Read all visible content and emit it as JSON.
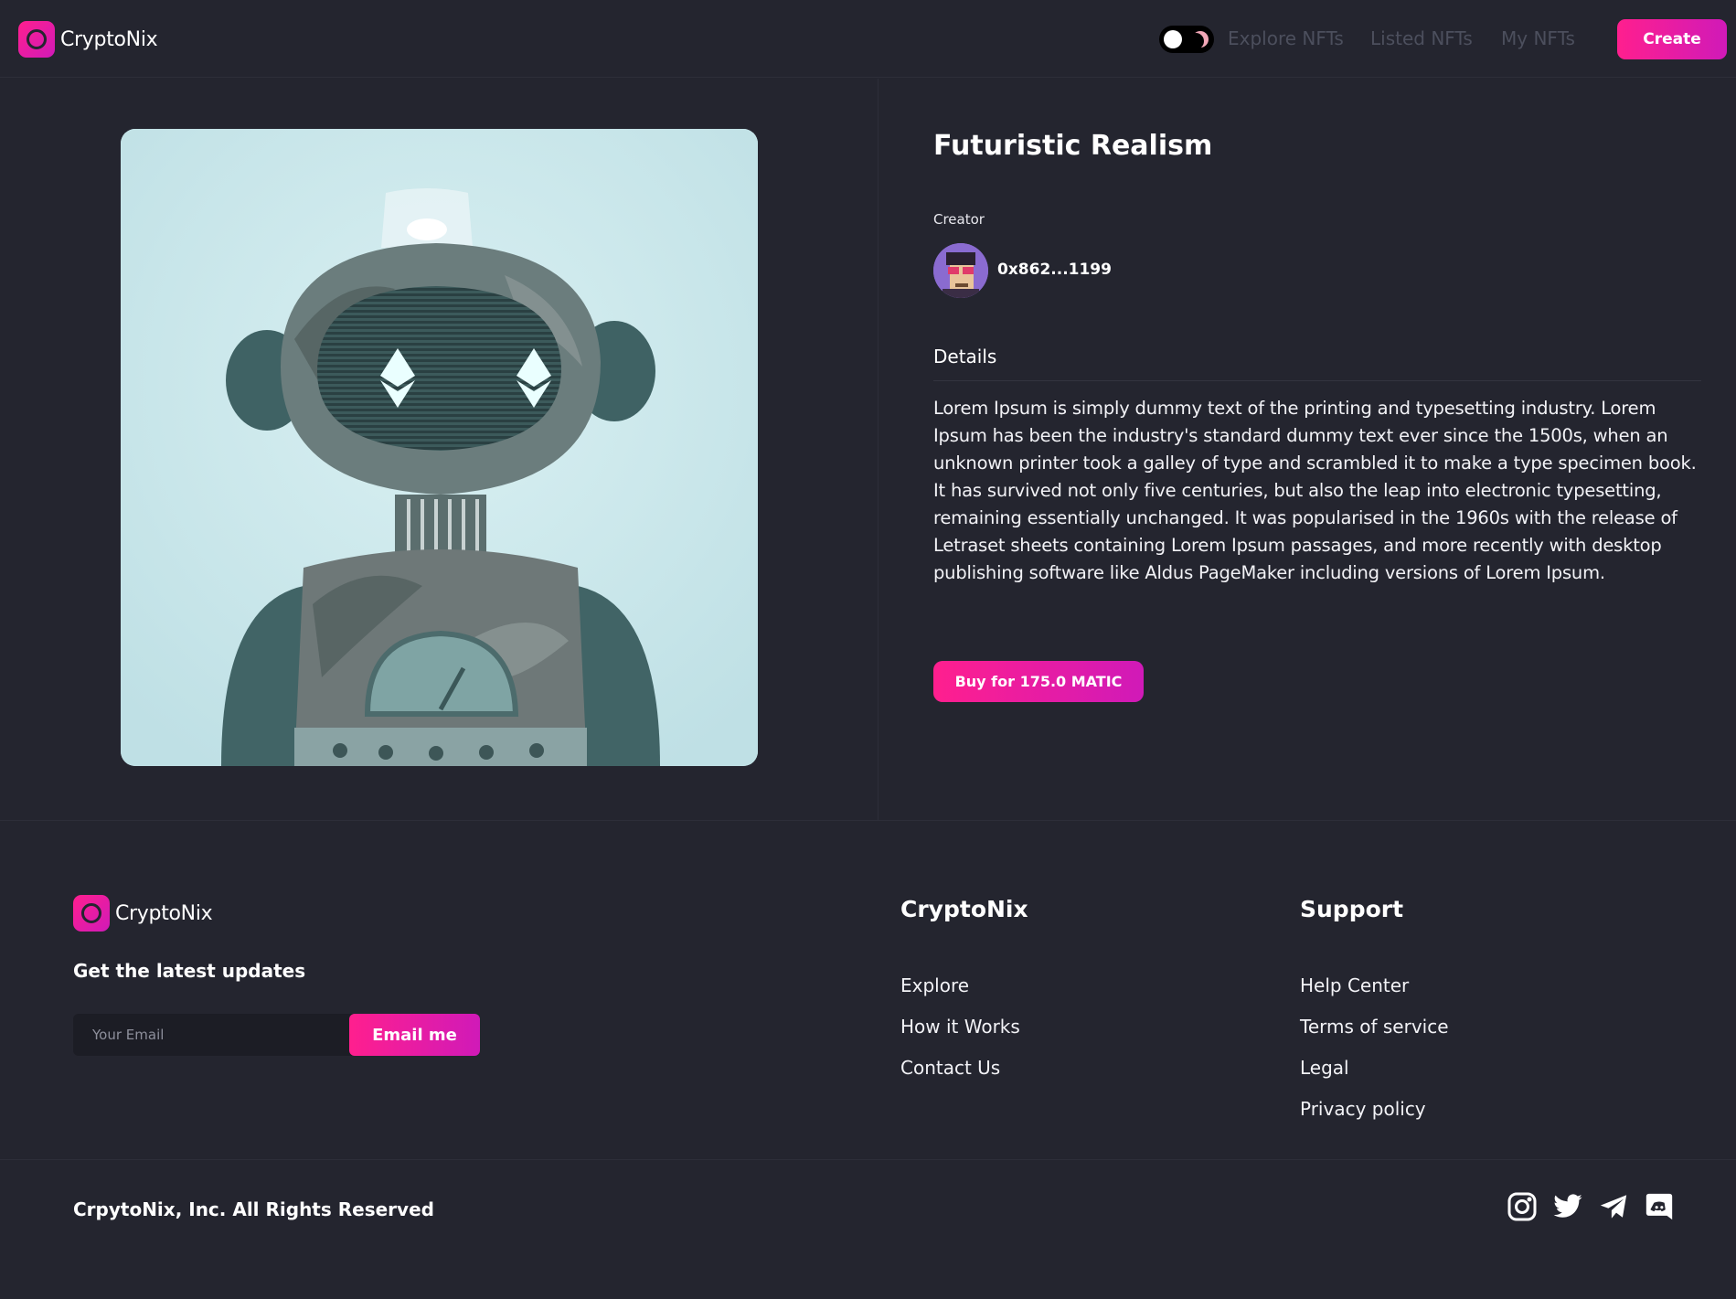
{
  "brand": {
    "name": "CryptoNix"
  },
  "header": {
    "nav": [
      "Explore NFTs",
      "Listed NFTs",
      "My NFTs"
    ],
    "create_label": "Create"
  },
  "nft": {
    "title": "Futuristic Realism",
    "creator_label": "Creator",
    "creator_address": "0x862...1199",
    "details_heading": "Details",
    "description": "Lorem Ipsum is simply dummy text of the printing and typesetting industry. Lorem Ipsum has been the industry's standard dummy text ever since the 1500s, when an unknown printer took a galley of type and scrambled it to make a type specimen book. It has survived not only five centuries, but also the leap into electronic typesetting, remaining essentially unchanged. It was popularised in the 1960s with the release of Letraset sheets containing Lorem Ipsum passages, and more recently with desktop publishing software like Aldus PageMaker including versions of Lorem Ipsum.",
    "buy_label": "Buy for 175.0 MATIC"
  },
  "footer": {
    "brand": "CryptoNix",
    "updates_heading": "Get the latest updates",
    "email_placeholder": "Your Email",
    "email_button": "Email me",
    "col1": {
      "heading": "CryptoNix",
      "links": [
        "Explore",
        "How it Works",
        "Contact Us"
      ]
    },
    "col2": {
      "heading": "Support",
      "links": [
        "Help Center",
        "Terms of service",
        "Legal",
        "Privacy policy"
      ]
    },
    "copyright": "CrpytoNix, Inc. All Rights Reserved",
    "social_icons": [
      "instagram-icon",
      "twitter-icon",
      "telegram-icon",
      "discord-icon"
    ]
  },
  "colors": {
    "background": "#24252f",
    "accent": "#ff1f8e",
    "accent_end": "#d01ab8",
    "nav_inactive": "#4c4f5d"
  }
}
